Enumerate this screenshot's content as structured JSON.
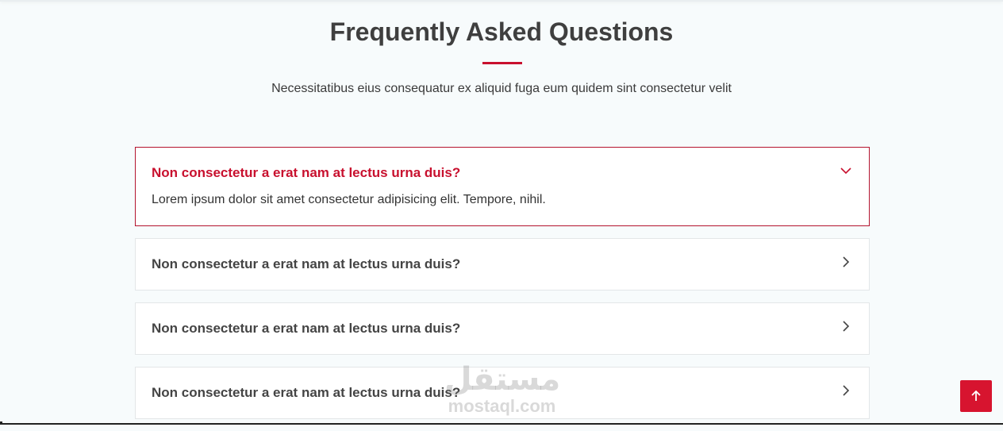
{
  "section": {
    "title": "Frequently Asked Questions",
    "subtitle": "Necessitatibus eius consequatur ex aliquid fuga eum quidem sint consectetur velit",
    "accent_color": "#c8102e"
  },
  "faq": [
    {
      "question": "Non consectetur a erat nam at lectus urna duis?",
      "answer": "Lorem ipsum dolor sit amet consectetur adipisicing elit. Tempore, nihil.",
      "expanded": true,
      "icon": "chevron-down-icon"
    },
    {
      "question": "Non consectetur a erat nam at lectus urna duis?",
      "expanded": false,
      "icon": "chevron-right-icon"
    },
    {
      "question": "Non consectetur a erat nam at lectus urna duis?",
      "expanded": false,
      "icon": "chevron-right-icon"
    },
    {
      "question": "Non consectetur a erat nam at lectus urna duis?",
      "expanded": false,
      "icon": "chevron-right-icon"
    }
  ],
  "watermark": {
    "arabic": "مستقل",
    "latin": "mostaql.com"
  },
  "back_to_top": {
    "icon": "arrow-up-icon",
    "color": "#d7142f"
  }
}
